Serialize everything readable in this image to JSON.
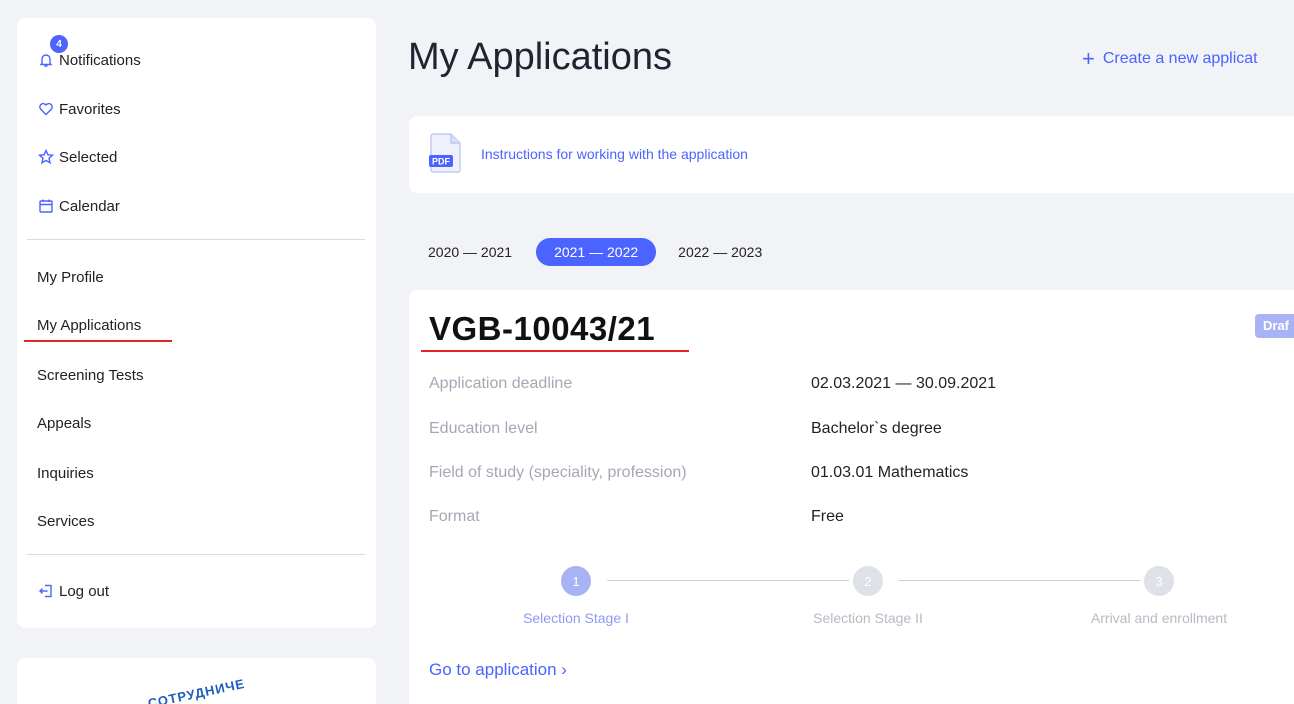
{
  "sidebar": {
    "notifications_count": "4",
    "items_top": [
      {
        "label": "Notifications",
        "icon": "bell-icon"
      },
      {
        "label": "Favorites",
        "icon": "heart-icon"
      },
      {
        "label": "Selected",
        "icon": "star-icon"
      },
      {
        "label": "Calendar",
        "icon": "calendar-icon"
      }
    ],
    "items_main": [
      {
        "label": "My Profile"
      },
      {
        "label": "My Applications"
      },
      {
        "label": "Screening Tests"
      },
      {
        "label": "Appeals"
      },
      {
        "label": "Inquiries"
      },
      {
        "label": "Services"
      }
    ],
    "logout_label": "Log out",
    "seal_text": "СОТРУДНИЧЕ"
  },
  "header": {
    "title": "My Applications",
    "create_label": "Create a new applicat"
  },
  "instructions": {
    "pdf_label": "PDF",
    "link_text": "Instructions for working with the application"
  },
  "years": [
    "2020 — 2021",
    "2021 — 2022",
    "2022 — 2023"
  ],
  "active_year": "2021 — 2022",
  "application": {
    "id": "VGB-10043/21",
    "status": "Draf",
    "fields": [
      {
        "label": "Application deadline",
        "value": "02.03.2021 — 30.09.2021"
      },
      {
        "label": "Education level",
        "value": "Bachelor`s degree"
      },
      {
        "label": "Field of study (speciality, profession)",
        "value": "01.03.01 Mathematics"
      },
      {
        "label": "Format",
        "value": "Free"
      }
    ],
    "steps": [
      {
        "num": "1",
        "label": "Selection Stage I",
        "active": true
      },
      {
        "num": "2",
        "label": "Selection Stage II",
        "active": false
      },
      {
        "num": "3",
        "label": "Arrival and enrollment",
        "active": false
      }
    ],
    "goto_label": "Go to application  ›"
  },
  "colors": {
    "accent": "#4b63ff",
    "badge": "#a8b3f5",
    "annotation_underline": "#e32424"
  }
}
